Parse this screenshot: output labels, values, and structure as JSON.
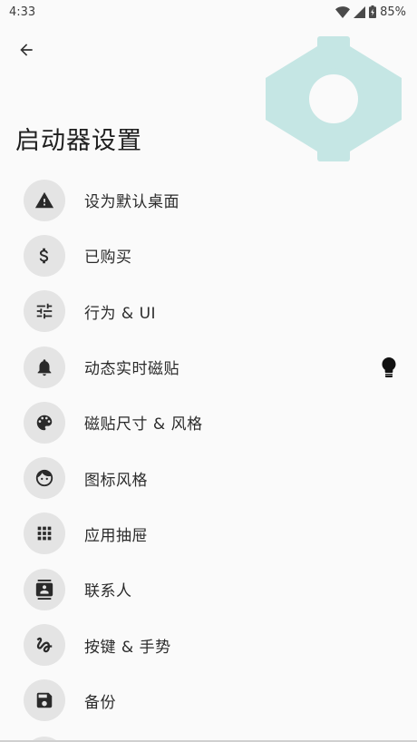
{
  "status_bar": {
    "time": "4:33",
    "battery": "85%"
  },
  "header": {
    "title": "启动器设置"
  },
  "accent_color": "#c5e6e4",
  "menu": {
    "items": [
      {
        "label": "设为默认桌面",
        "icon": "warning-icon"
      },
      {
        "label": "已购买",
        "icon": "dollar-icon"
      },
      {
        "label": "行为 & UI",
        "icon": "tune-icon"
      },
      {
        "label": "动态实时磁贴",
        "icon": "bell-icon",
        "trailing_icon": "lightbulb-icon"
      },
      {
        "label": "磁贴尺寸 & 风格",
        "icon": "palette-icon"
      },
      {
        "label": "图标风格",
        "icon": "face-icon"
      },
      {
        "label": "应用抽屉",
        "icon": "grid-icon"
      },
      {
        "label": "联系人",
        "icon": "contacts-icon"
      },
      {
        "label": "按键 & 手势",
        "icon": "gesture-icon"
      },
      {
        "label": "备份",
        "icon": "save-icon"
      }
    ]
  }
}
